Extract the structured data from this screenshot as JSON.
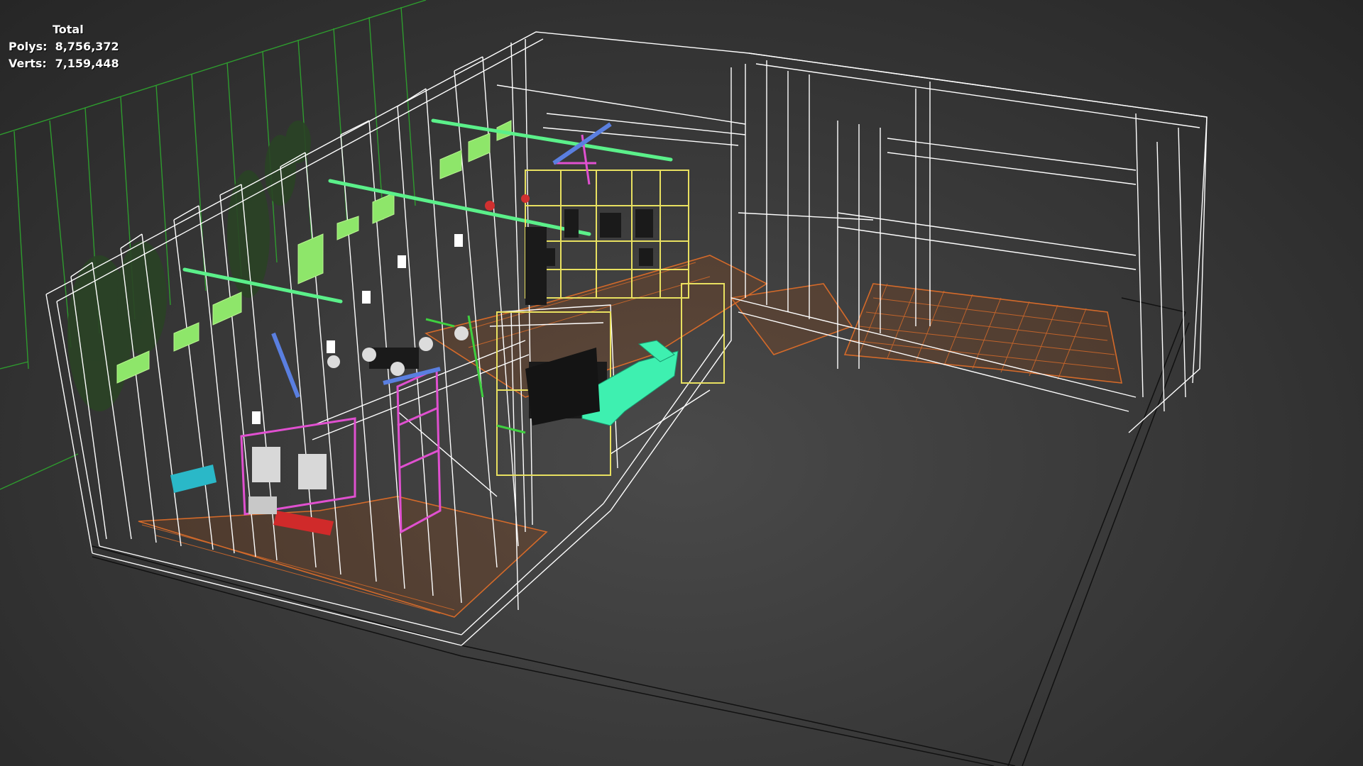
{
  "viewport": {
    "stats": {
      "title": "Total",
      "polys_label": "Polys:",
      "polys_value": "8,756,372",
      "verts_label": "Verts:",
      "verts_value": "7,159,448"
    },
    "colors": {
      "background": "#3a3a3a",
      "wireframe_walls": "#ffffff",
      "floor_parquet": "#d46a2a",
      "grid": "#2e9c2e",
      "light_panels": "#8ee66a",
      "linear_lights": "#5bf08a",
      "shelving": "#e8e060",
      "partition": "#e050d0",
      "sofa": "#3ef0b0",
      "counter": "#2ab8c8",
      "couch_red": "#d02a2a",
      "plants": "#2f4a2a"
    }
  }
}
